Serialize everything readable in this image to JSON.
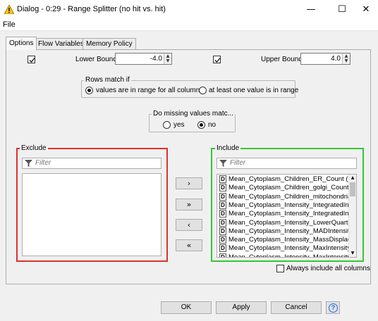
{
  "window": {
    "title": "Dialog - 0:29 - Range Splitter (no hit vs. hit)",
    "minimize": "—",
    "maximize": "☐",
    "close": "✕"
  },
  "menu": {
    "file": "File"
  },
  "tabs": [
    {
      "label": "Options"
    },
    {
      "label": "Flow Variables"
    },
    {
      "label": "Memory Policy"
    }
  ],
  "bounds": {
    "lower_label": "Lower Bound",
    "lower_value": "-4.0",
    "lower_checked": true,
    "upper_label": "Upper Bound",
    "upper_value": "4.0",
    "upper_checked": true
  },
  "rows_match": {
    "legend": "Rows match if",
    "option_all": "values are in range for all columns",
    "option_any": "at least one value is in range",
    "selected": "all"
  },
  "missing": {
    "legend": "Do missing values matc...",
    "yes": "yes",
    "no": "no",
    "selected": "no"
  },
  "exclude": {
    "legend": "Exclude",
    "filter_placeholder": "Filter",
    "border_color": "#e03030"
  },
  "include": {
    "legend": "Include",
    "filter_placeholder": "Filter",
    "border_color": "#32c832",
    "type_badge": "D",
    "items": [
      "Mean_Cytoplasm_Children_ER_Count (M...",
      "Mean_Cytoplasm_Children_golgi_Count (...",
      "Mean_Cytoplasm_Children_mitochondria_...",
      "Mean_Cytoplasm_Intensity_IntegratedInt...",
      "Mean_Cytoplasm_Intensity_IntegratedInt...",
      "Mean_Cytoplasm_Intensity_LowerQuartil...",
      "Mean_Cytoplasm_Intensity_MADIntensity...",
      "Mean_Cytoplasm_Intensity_MassDisplac...",
      "Mean_Cytoplasm_Intensity_MaxIntensity...",
      "Mean_Cytoplasm_Intensity_MaxIntensity..."
    ]
  },
  "move_buttons": {
    "add": "›",
    "add_all": "»",
    "remove": "‹",
    "remove_all": "«"
  },
  "always_include": {
    "label": "Always include all columns",
    "checked": false
  },
  "footer": {
    "ok": "OK",
    "apply": "Apply",
    "cancel": "Cancel",
    "help": "?"
  },
  "colors": {
    "accent_help": "#1e6fd9",
    "warning_icon": "#f5c518"
  }
}
